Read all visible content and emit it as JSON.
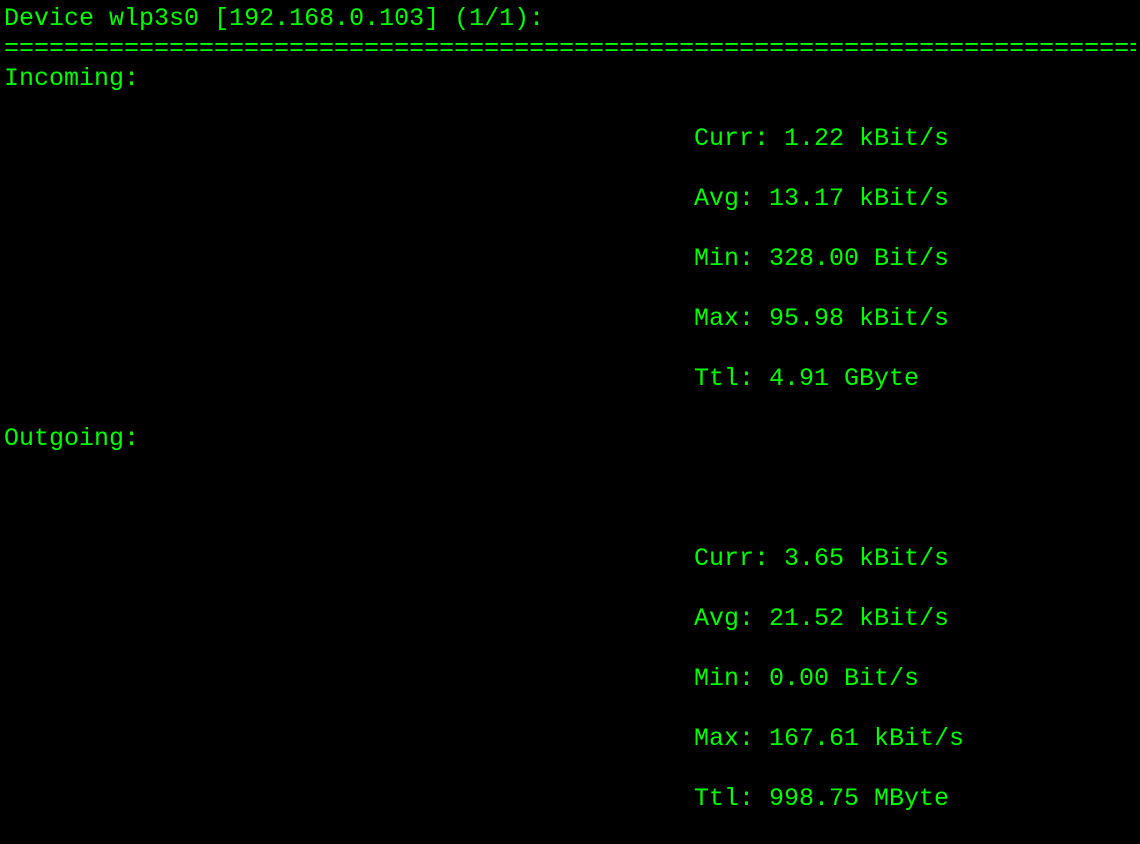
{
  "header": {
    "device_label": "Device",
    "interface": "wlp3s0",
    "ip": "[192.168.0.103]",
    "pager": "(1/1):"
  },
  "divider": "================================================================================",
  "incoming": {
    "label": "Incoming:",
    "stats": {
      "curr": "Curr: 1.22 kBit/s",
      "avg": "Avg: 13.17 kBit/s",
      "min": "Min: 328.00 Bit/s",
      "max": "Max: 95.98 kBit/s",
      "ttl": "Ttl: 4.91 GByte"
    }
  },
  "outgoing": {
    "label": "Outgoing:",
    "stats": {
      "curr": "Curr: 3.65 kBit/s",
      "avg": "Avg: 21.52 kBit/s",
      "min": "Min: 0.00 Bit/s",
      "max": "Max: 167.61 kBit/s",
      "ttl": "Ttl: 998.75 MByte"
    }
  }
}
